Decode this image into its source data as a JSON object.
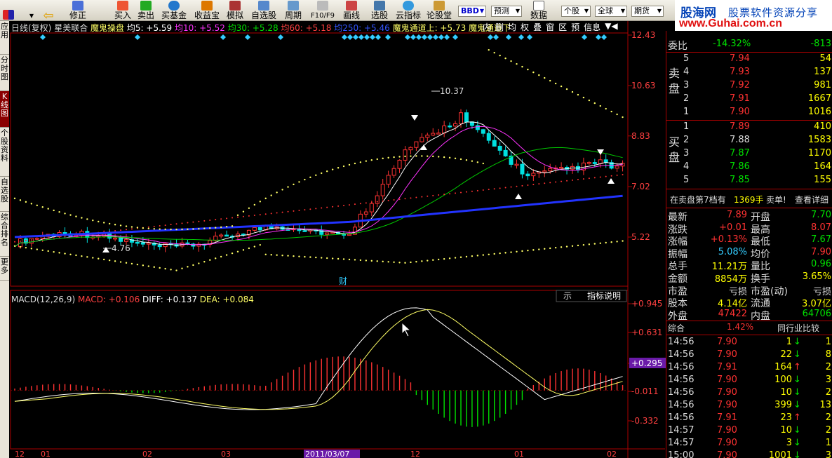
{
  "toolbar": {
    "buttons": [
      "修正",
      "买入",
      "卖出",
      "买基金",
      "收益宝",
      "模拟",
      "自选股",
      "周期",
      "F10/F9",
      "画线",
      "选股",
      "云指标",
      "论股堂",
      "数据"
    ],
    "combos": [
      "BBD",
      "预测",
      "个股",
      "全球",
      "期货"
    ]
  },
  "logo": {
    "brand": "股海网",
    "slogan": "股票软件资源分享",
    "url": "www.Guhai.com.cn"
  },
  "left_tabs": [
    "应用",
    "分时图",
    "K线图",
    "个股资料",
    "自选股",
    "综合排名",
    "更多"
  ],
  "chart": {
    "header": {
      "period": "日线(复权)",
      "name": "星美联合",
      "indicator": "魔鬼操盘",
      "ma5": "均5: +5.59",
      "ma10": "均10: +5.52",
      "ma30": "均30: +5.28",
      "ma60": "均60: +5.18",
      "ma250": "均250: +5.46",
      "channel_up": "魔鬼通道上: +5.73",
      "channel_dn": "魔鬼通道下"
    },
    "sub_toolbar": [
      "内",
      "删",
      "均",
      "权",
      "叠",
      "窗",
      "区",
      "预",
      "信息"
    ],
    "price_axis": [
      "12.43",
      "10.63",
      "8.83",
      "7.02",
      "5.22"
    ],
    "high_label": "10.37",
    "low_label": "4.76",
    "cai_label": "财",
    "macd_header": {
      "name": "MACD(12,26,9)",
      "macd": "MACD: +0.106",
      "diff": "DIFF: +0.137",
      "dea": "DEA: +0.084"
    },
    "macd_axis": [
      "+0.945",
      "+0.631",
      "+0.295",
      "-0.011",
      "-0.332"
    ],
    "macd_highlight": "+0.295",
    "indicator_buttons": [
      "示",
      "指标说明"
    ],
    "date_labels": [
      "12",
      "01",
      "02",
      "03",
      "2011/03/07",
      "12",
      "01",
      "02"
    ],
    "colors": {
      "up": "#ff3232",
      "down": "#00e000",
      "ma5": "#ffffff",
      "ma10": "#ff33ff",
      "ma30": "#00c800",
      "ma250": "#2233ff",
      "channel": "#ffff66"
    }
  },
  "quote": {
    "weibi": {
      "label": "委比",
      "pct": "-14.32%",
      "diff": "-813"
    },
    "sell": [
      {
        "lvl": "5",
        "price": "7.94",
        "vol": "54"
      },
      {
        "lvl": "4",
        "price": "7.93",
        "vol": "137"
      },
      {
        "lvl": "3",
        "price": "7.92",
        "vol": "981"
      },
      {
        "lvl": "2",
        "price": "7.91",
        "vol": "1667"
      },
      {
        "lvl": "1",
        "price": "7.90",
        "vol": "1016"
      }
    ],
    "buy": [
      {
        "lvl": "1",
        "price": "7.89",
        "vol": "410"
      },
      {
        "lvl": "2",
        "price": "7.88",
        "vol": "1583"
      },
      {
        "lvl": "3",
        "price": "7.87",
        "vol": "1170"
      },
      {
        "lvl": "4",
        "price": "7.86",
        "vol": "164"
      },
      {
        "lvl": "5",
        "price": "7.85",
        "vol": "155"
      }
    ],
    "sell_label": "卖盘",
    "buy_label": "买盘",
    "notice": {
      "text": "在卖盘第7档有",
      "amount": "1369手",
      "action": "卖单!",
      "detail": "查看详细"
    },
    "stats": [
      {
        "k1": "最新",
        "v1": "7.89",
        "c1": "up",
        "k2": "开盘",
        "v2": "7.70",
        "c2": "dn"
      },
      {
        "k1": "涨跌",
        "v1": "+0.01",
        "c1": "up",
        "k2": "最高",
        "v2": "8.07",
        "c2": "up"
      },
      {
        "k1": "涨幅",
        "v1": "+0.13%",
        "c1": "up",
        "k2": "最低",
        "v2": "7.67",
        "c2": "dn"
      },
      {
        "k1": "振幅",
        "v1": "5.08%",
        "c1": "cy",
        "k2": "均价",
        "v2": "7.90",
        "c2": "up"
      },
      {
        "k1": "总手",
        "v1": "11.21万",
        "c1": "ye",
        "k2": "量比",
        "v2": "0.96",
        "c2": "dn"
      },
      {
        "k1": "金额",
        "v1": "8854万",
        "c1": "ye",
        "k2": "换手",
        "v2": "3.65%",
        "c2": "ye"
      },
      {
        "k1": "市盈",
        "v1": "亏损",
        "c1": "wh",
        "k2": "市盈(动)",
        "v2": "亏损",
        "c2": "wh"
      },
      {
        "k1": "股本",
        "v1": "4.14亿",
        "c1": "ye",
        "k2": "流通",
        "v2": "3.07亿",
        "c2": "ye"
      },
      {
        "k1": "外盘",
        "v1": "47422",
        "c1": "up",
        "k2": "内盘",
        "v2": "64706",
        "c2": "dn"
      }
    ],
    "sector": {
      "label": "综合",
      "pct": "1.42%",
      "button": "同行业比较"
    },
    "ticks": [
      {
        "t": "14:56",
        "p": "7.90",
        "v": "1",
        "dir": "down",
        "n": "1"
      },
      {
        "t": "14:56",
        "p": "7.90",
        "v": "22",
        "dir": "down",
        "n": "8"
      },
      {
        "t": "14:56",
        "p": "7.91",
        "v": "164",
        "dir": "up",
        "n": "2"
      },
      {
        "t": "14:56",
        "p": "7.90",
        "v": "100",
        "dir": "down",
        "n": "3"
      },
      {
        "t": "14:56",
        "p": "7.90",
        "v": "10",
        "dir": "down",
        "n": "2"
      },
      {
        "t": "14:56",
        "p": "7.90",
        "v": "399",
        "dir": "down",
        "n": "13"
      },
      {
        "t": "14:56",
        "p": "7.91",
        "v": "23",
        "dir": "up",
        "n": "2"
      },
      {
        "t": "14:57",
        "p": "7.90",
        "v": "10",
        "dir": "down",
        "n": "2"
      },
      {
        "t": "14:57",
        "p": "7.90",
        "v": "3",
        "dir": "down",
        "n": "1"
      },
      {
        "t": "15:00",
        "p": "7.90",
        "v": "1001",
        "dir": "down",
        "n": "3"
      }
    ]
  }
}
